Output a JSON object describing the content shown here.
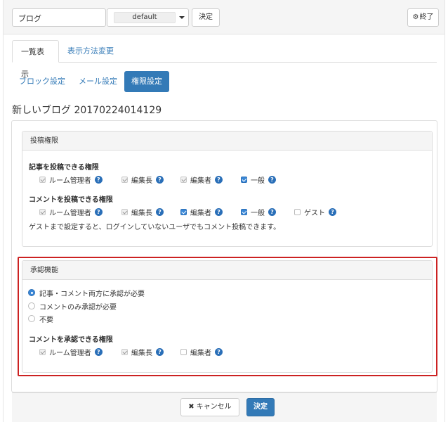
{
  "topbar": {
    "title_value": "ブログ",
    "frame_select_value": "default",
    "decide_label": "決定",
    "close_label": "終了",
    "close_icon": "gear-icon"
  },
  "tabs": [
    {
      "label": "一覧表示",
      "active": true
    },
    {
      "label": "表示方法変更",
      "active": false
    }
  ],
  "subnav": [
    {
      "label": "ブロック設定",
      "active": false
    },
    {
      "label": "メール設定",
      "active": false
    },
    {
      "label": "権限設定",
      "active": true
    }
  ],
  "blog_title": "新しいブログ 20170224014129",
  "post_panel": {
    "heading": "投稿権限",
    "article_label": "記事を投稿できる権限",
    "article_roles": [
      {
        "label": "ルーム管理者",
        "state": "locked"
      },
      {
        "label": "編集長",
        "state": "locked"
      },
      {
        "label": "編集者",
        "state": "locked"
      },
      {
        "label": "一般",
        "state": "checked"
      }
    ],
    "comment_label": "コメントを投稿できる権限",
    "comment_roles": [
      {
        "label": "ルーム管理者",
        "state": "locked"
      },
      {
        "label": "編集長",
        "state": "locked"
      },
      {
        "label": "編集者",
        "state": "checked"
      },
      {
        "label": "一般",
        "state": "checked"
      },
      {
        "label": "ゲスト",
        "state": "unchecked"
      }
    ],
    "note": "ゲストまで設定すると、ログインしていないユーザでもコメント投稿できます。"
  },
  "approve_panel": {
    "heading": "承認機能",
    "options": [
      {
        "label": "記事・コメント両方に承認が必要",
        "selected": true
      },
      {
        "label": "コメントのみ承認が必要",
        "selected": false
      },
      {
        "label": "不要",
        "selected": false
      }
    ],
    "comment_approve_label": "コメントを承認できる権限",
    "approve_roles": [
      {
        "label": "ルーム管理者",
        "state": "locked"
      },
      {
        "label": "編集長",
        "state": "locked"
      },
      {
        "label": "編集者",
        "state": "unchecked"
      }
    ]
  },
  "footer": {
    "cancel_label": "キャンセル",
    "submit_label": "決定"
  },
  "colors": {
    "accent": "#337ab7",
    "highlight_border": "#cc2222"
  }
}
